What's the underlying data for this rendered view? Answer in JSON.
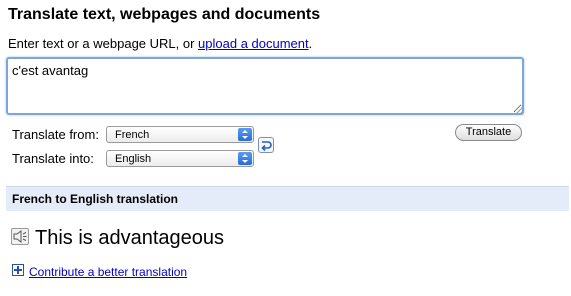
{
  "header": {
    "title": "Translate text, webpages and documents",
    "instructions_prefix": "Enter text or a webpage URL, or ",
    "upload_link": "upload a document",
    "instructions_suffix": "."
  },
  "input": {
    "value": "c'est avantag"
  },
  "from_lang": {
    "label": "Translate from:",
    "selected": "French"
  },
  "to_lang": {
    "label": "Translate into:",
    "selected": "English"
  },
  "translate_button": {
    "label": "Translate"
  },
  "result": {
    "heading": "French to English translation",
    "text": "This is advantageous",
    "contribute_link": "Contribute a better translation"
  },
  "colors": {
    "result_bar": "#e5ecf9",
    "link": "#0000cc",
    "select_arrow": "#2a6bd8"
  },
  "icons": {
    "swap": "swap-languages-icon",
    "speaker": "speaker-icon",
    "contribute": "plus-icon"
  }
}
